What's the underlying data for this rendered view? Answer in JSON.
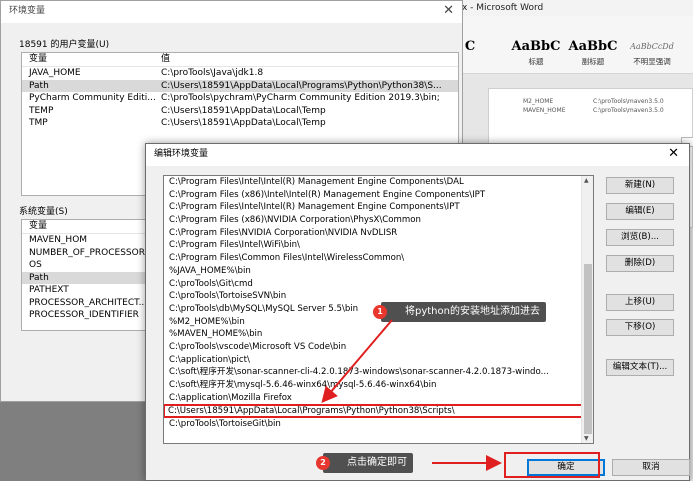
{
  "word": {
    "title": "x - Microsoft Word",
    "styles": [
      {
        "preview": "AaBbC",
        "caption": "标题"
      },
      {
        "preview": "AaBbC",
        "caption": "副标题"
      },
      {
        "preview": "AaBbCcDd",
        "caption": "不明显强调"
      }
    ],
    "doc_rows": [
      {
        "name": "M2_HOME",
        "value": "C:\\proTools\\maven3.5.0"
      },
      {
        "name": "MAVEN_HOME",
        "value": "C:\\proTools\\maven3.5.0"
      }
    ]
  },
  "env_dialog": {
    "title": "环境变量",
    "user_group_label": "18591 的用户变量(U)",
    "system_group_label": "系统变量(S)",
    "col_var": "变量",
    "col_val": "值",
    "user_vars": [
      {
        "name": "JAVA_HOME",
        "value": "C:\\proTools\\Java\\jdk1.8"
      },
      {
        "name": "Path",
        "value": "C:\\Users\\18591\\AppData\\Local\\Programs\\Python\\Python38\\S..."
      },
      {
        "name": "PyCharm Community Editi...",
        "value": "C:\\proTools\\pychram\\PyCharm Community Edition 2019.3\\bin;"
      },
      {
        "name": "TEMP",
        "value": "C:\\Users\\18591\\AppData\\Local\\Temp"
      },
      {
        "name": "TMP",
        "value": "C:\\Users\\18591\\AppData\\Local\\Temp"
      }
    ],
    "system_vars": [
      {
        "name": "MAVEN_HOM"
      },
      {
        "name": "NUMBER_OF_PROCESSOR"
      },
      {
        "name": "OS"
      },
      {
        "name": "Path"
      },
      {
        "name": "PATHEXT"
      },
      {
        "name": "PROCESSOR_ARCHITECT..."
      },
      {
        "name": "PROCESSOR_IDENTIFIER"
      }
    ]
  },
  "edit_dialog": {
    "title": "编辑环境变量",
    "paths": [
      "C:\\Program Files\\Intel\\Intel(R) Management Engine Components\\DAL",
      "C:\\Program Files (x86)\\Intel\\Intel(R) Management Engine Components\\IPT",
      "C:\\Program Files\\Intel\\Intel(R) Management Engine Components\\IPT",
      "C:\\Program Files (x86)\\NVIDIA Corporation\\PhysX\\Common",
      "C:\\Program Files\\NVIDIA Corporation\\NVIDIA NvDLISR",
      "C:\\Program Files\\Intel\\WiFi\\bin\\",
      "C:\\Program Files\\Common Files\\Intel\\WirelessCommon\\",
      "%JAVA_HOME%\\bin",
      "C:\\proTools\\Git\\cmd",
      "C:\\proTools\\TortoiseSVN\\bin",
      "C:\\proTools\\db\\MySQL\\MySQL Server 5.5\\bin",
      "%M2_HOME%\\bin",
      "%MAVEN_HOME%\\bin",
      "C:\\proTools\\vscode\\Microsoft VS Code\\bin",
      "C:\\application\\pict\\",
      "C:\\soft\\程序开发\\sonar-scanner-cli-4.2.0.1873-windows\\sonar-scanner-4.2.0.1873-windo...",
      "C:\\soft\\程序开发\\mysql-5.6.46-winx64\\mysql-5.6.46-winx64\\bin",
      "C:\\application\\Mozilla Firefox",
      "C:\\Users\\18591\\AppData\\Local\\Programs\\Python\\Python38\\Scripts\\",
      "C:\\proTools\\TortoiseGit\\bin"
    ],
    "selected_index": 18,
    "buttons": {
      "new": "新建(N)",
      "edit": "编辑(E)",
      "browse": "浏览(B)...",
      "delete": "删除(D)",
      "up": "上移(U)",
      "down": "下移(O)",
      "edit_text": "编辑文本(T)...",
      "ok": "确定",
      "cancel": "取消"
    }
  },
  "annotations": {
    "step1_num": "1",
    "step1_text": "将python的安装地址添加进去",
    "step2_num": "2",
    "step2_text": "点击确定即可",
    "color": "#e02020"
  }
}
